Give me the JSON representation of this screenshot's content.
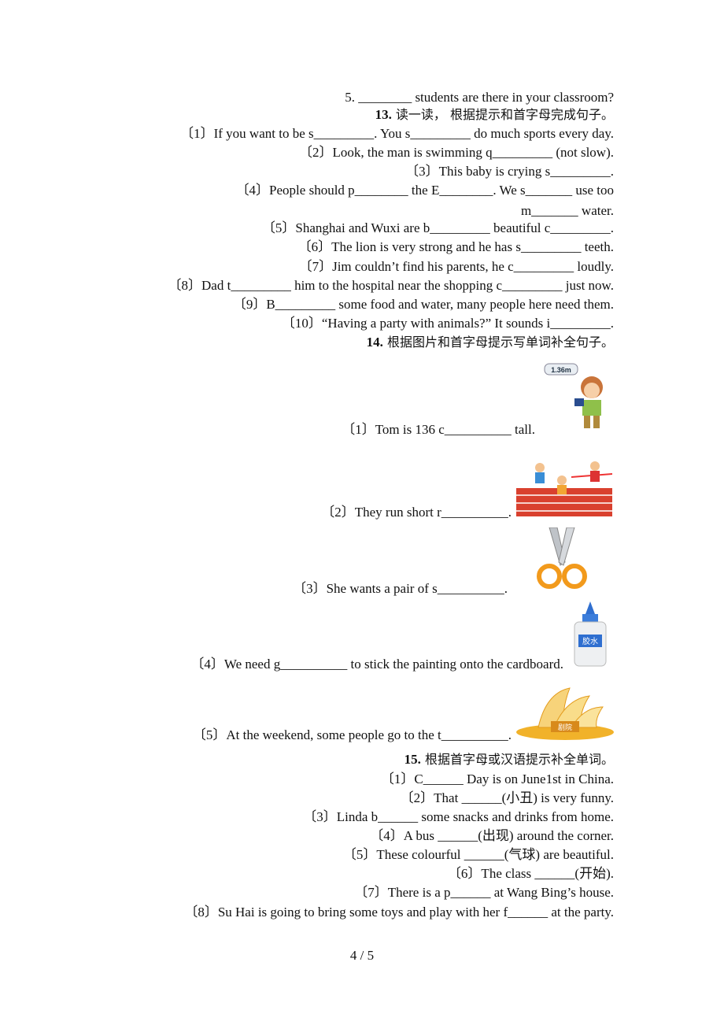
{
  "q5_line": "5. ________ students are there in your classroom?",
  "s13": {
    "num": "13.",
    "title": "读一读， 根据提示和首字母完成句子。",
    "items": [
      "〔1〕If you want to be s_________. You s_________ do much sports every day.",
      "〔2〕Look, the man is swimming q_________ (not slow).",
      "〔3〕This baby is crying s_________.",
      "〔4〕People should p________ the E________. We s_______ use too",
      "m_______ water.",
      "〔5〕Shanghai and Wuxi are b_________ beautiful c_________.",
      "〔6〕The lion is very strong and he has s_________ teeth.",
      "〔7〕Jim couldn’t find his parents, he c_________ loudly.",
      "〔8〕Dad t_________ him to the hospital near the shopping c_________ just now.",
      "〔9〕B_________ some food and water, many people here need them.",
      "〔10〕“Having a party with animals?” It sounds i_________."
    ]
  },
  "s14": {
    "num": "14.",
    "title": "根据图片和首字母提示写单词补全句子。",
    "items": [
      "〔1〕Tom is 136 c__________ tall.",
      "〔2〕They run short r__________.",
      "〔3〕She wants a pair of s__________.",
      "〔4〕We need g__________ to stick the painting onto the cardboard.",
      "〔5〕At the weekend, some people go to the t__________."
    ],
    "images": [
      {
        "icon": "boy-height-icon",
        "label": "1.36m"
      },
      {
        "icon": "runners-icon"
      },
      {
        "icon": "scissors-icon"
      },
      {
        "icon": "glue-bottle-icon",
        "label": "胶水"
      },
      {
        "icon": "theatre-icon",
        "label": "剧院"
      }
    ]
  },
  "s15": {
    "num": "15.",
    "title": "根据首字母或汉语提示补全单词。",
    "items": [
      "〔1〕C______ Day is on June1st in China.",
      "〔2〕That ______(小丑) is very funny.",
      "〔3〕Linda b______ some snacks and drinks from home.",
      "〔4〕A bus ______(出现) around the corner.",
      "〔5〕These colourful ______(气球) are beautiful.",
      "〔6〕The class ______(开始).",
      "〔7〕There is a p______ at Wang Bing’s house.",
      "〔8〕Su Hai is going to bring some toys and play with her f______ at the party."
    ]
  },
  "page_number": "4 / 5"
}
